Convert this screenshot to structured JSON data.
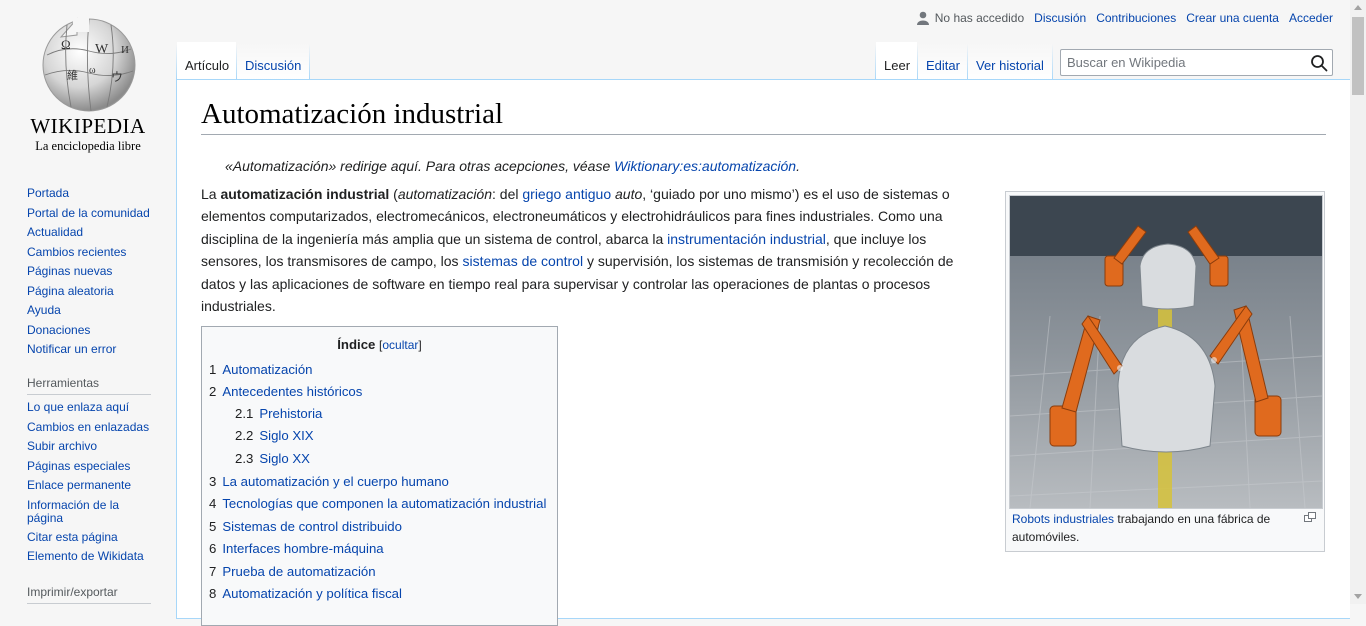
{
  "logo": {
    "wordmark": "Wikipedia",
    "tagline": "La enciclopedia libre"
  },
  "sidebar": {
    "navigation": [
      {
        "label": "Portada"
      },
      {
        "label": "Portal de la comunidad"
      },
      {
        "label": "Actualidad"
      },
      {
        "label": "Cambios recientes"
      },
      {
        "label": "Páginas nuevas"
      },
      {
        "label": "Página aleatoria"
      },
      {
        "label": "Ayuda"
      },
      {
        "label": "Donaciones"
      },
      {
        "label": "Notificar un error"
      }
    ],
    "tools_heading": "Herramientas",
    "tools": [
      {
        "label": "Lo que enlaza aquí"
      },
      {
        "label": "Cambios en enlazadas"
      },
      {
        "label": "Subir archivo"
      },
      {
        "label": "Páginas especiales"
      },
      {
        "label": "Enlace permanente"
      },
      {
        "label": "Información de la página"
      },
      {
        "label": "Citar esta página"
      },
      {
        "label": "Elemento de Wikidata"
      }
    ],
    "print_heading": "Imprimir/exportar"
  },
  "personal": {
    "anon": "No has accedido",
    "links": [
      "Discusión",
      "Contribuciones",
      "Crear una cuenta",
      "Acceder"
    ]
  },
  "tabs": {
    "left": [
      "Artículo",
      "Discusión"
    ],
    "right": [
      "Leer",
      "Editar",
      "Ver historial"
    ]
  },
  "search": {
    "placeholder": "Buscar en Wikipedia"
  },
  "article": {
    "title": "Automatización industrial",
    "hatnote_text": "«Automatización» redirige aquí. Para otras acepciones, véase ",
    "hatnote_link": "Wiktionary:es:automatización",
    "hatnote_end": ".",
    "lead": {
      "p1": "La ",
      "bold": "automatización industrial",
      "p2": " (",
      "ital1": "automatización",
      "p3": ": del ",
      "link1": "griego antiguo",
      "p4": " ",
      "ital2": "auto",
      "p5": ", ‘guiado por uno mismo’) es el uso de sistemas o elementos computarizados, electromecánicos, electroneumáticos y electrohidráulicos para fines industriales. Como una disciplina de la ingeniería más amplia que un sistema de control, abarca la ",
      "link2": "instrumentación industrial",
      "p6": ", que incluye los sensores, los transmisores de campo, los ",
      "link3": "sistemas de control",
      "p7": " y supervisión, los sistemas de transmisión y recolección de datos y las aplicaciones de software en tiempo real para supervisar y controlar las operaciones de plantas o procesos industriales."
    },
    "figure": {
      "caption_link": "Robots industriales",
      "caption_text": " trabajando en una fábrica de automóviles."
    }
  },
  "toc": {
    "title": "Índice",
    "toggle_open": "[",
    "toggle": "ocultar",
    "toggle_close": "]",
    "items": [
      {
        "num": "1",
        "label": "Automatización"
      },
      {
        "num": "2",
        "label": "Antecedentes históricos"
      },
      {
        "num": "2.1",
        "label": "Prehistoria"
      },
      {
        "num": "2.2",
        "label": "Siglo XIX"
      },
      {
        "num": "2.3",
        "label": "Siglo XX"
      },
      {
        "num": "3",
        "label": "La automatización y el cuerpo humano"
      },
      {
        "num": "4",
        "label": "Tecnologías que componen la automatización industrial"
      },
      {
        "num": "5",
        "label": "Sistemas de control distribuido"
      },
      {
        "num": "6",
        "label": "Interfaces hombre-máquina"
      },
      {
        "num": "7",
        "label": "Prueba de automatización"
      },
      {
        "num": "8",
        "label": "Automatización y política fiscal"
      }
    ]
  },
  "colors": {
    "link": "#0645ad",
    "text": "#202122",
    "border_blue": "#a7d7f9"
  }
}
